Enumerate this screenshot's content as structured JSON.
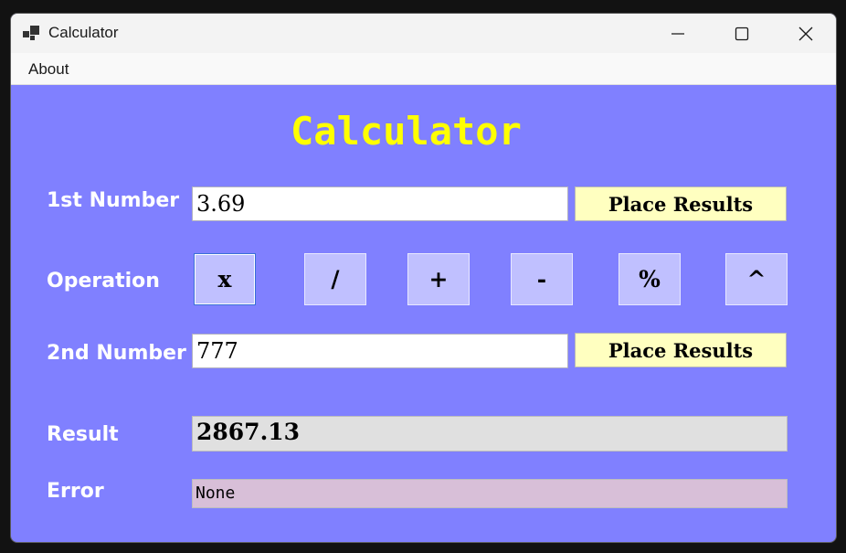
{
  "window": {
    "title": "Calculator",
    "icon": "app-window-icon",
    "controls": {
      "minimize": "minimize-icon",
      "maximize": "maximize-icon",
      "close": "close-icon"
    }
  },
  "menu": {
    "items": [
      {
        "label": "About"
      }
    ]
  },
  "form": {
    "heading": "Calculator",
    "first_number": {
      "label": "1st Number",
      "value": "3.69",
      "button_label": "Place Results"
    },
    "operation": {
      "label": "Operation",
      "buttons": [
        {
          "label": "x"
        },
        {
          "label": "/"
        },
        {
          "label": "+"
        },
        {
          "label": "-"
        },
        {
          "label": "%"
        },
        {
          "label": "^"
        }
      ],
      "selected": "x"
    },
    "second_number": {
      "label": "2nd Number",
      "value": "777",
      "button_label": "Place Results"
    },
    "result": {
      "label": "Result",
      "value": "2867.13"
    },
    "error": {
      "label": "Error",
      "value": "None"
    }
  },
  "colors": {
    "background": "#8080ff",
    "heading": "#ffff00",
    "place_button": "#ffffc0",
    "operation_button": "#c0c0ff",
    "result_box": "#e0e0e0",
    "error_box": "#d8bfd8"
  }
}
